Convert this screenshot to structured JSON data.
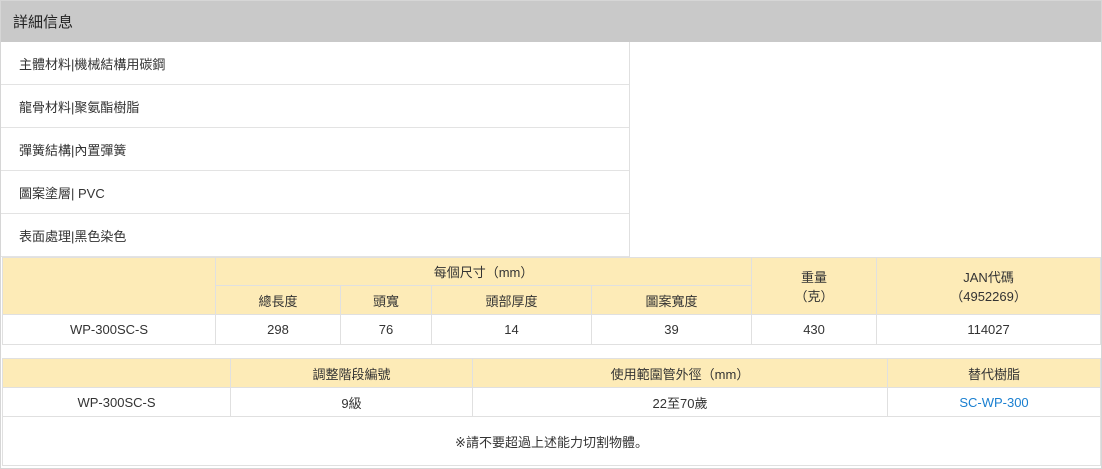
{
  "panel": {
    "title": "詳細信息"
  },
  "specs": [
    "主體材料|機械結構用碳鋼",
    "龍骨材料|聚氨酯樹脂",
    "彈簧結構|內置彈簧",
    "圖案塗層| PVC",
    "表面處理|黑色染色"
  ],
  "table1": {
    "group_header": "每個尺寸（mm）",
    "weight_header_line1": "重量",
    "weight_header_line2": "（克）",
    "jan_header_line1": "JAN代碼",
    "jan_header_line2": "（4952269）",
    "sub_headers": [
      "總長度",
      "頭寬",
      "頭部厚度",
      "圖案寬度"
    ],
    "row": {
      "model": "WP-300SC-S",
      "total_length": "298",
      "head_width": "76",
      "head_thickness": "14",
      "pattern_width": "39",
      "weight": "430",
      "jan": "114027"
    }
  },
  "table2": {
    "headers": [
      "調整階段編號",
      "使用範圍管外徑（mm）",
      "替代樹脂"
    ],
    "row": {
      "model": "WP-300SC-S",
      "stages": "9級",
      "range": "22至70歲",
      "replacement": "SC-WP-300"
    },
    "note": "※請不要超過上述能力切割物體。"
  },
  "colors": {
    "header_bg": "#c9c9c9",
    "table_header_bg": "#fdebb7",
    "link": "#1a7fd0"
  }
}
